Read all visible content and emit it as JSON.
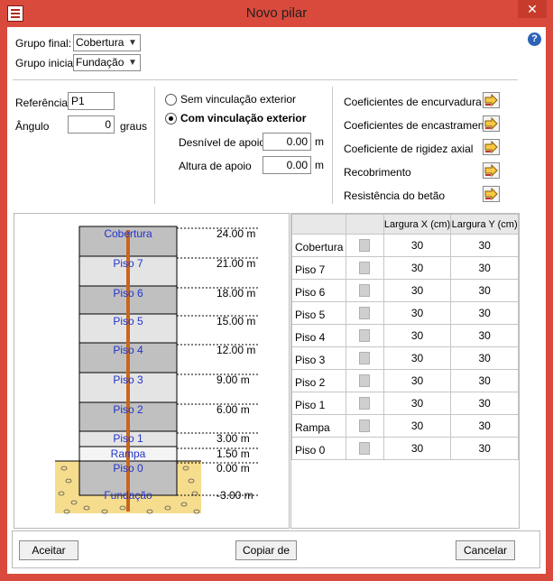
{
  "window": {
    "title": "Novo pilar",
    "close_glyph": "✕"
  },
  "help": {
    "glyph": "?"
  },
  "groups": {
    "final_label": "Grupo final:",
    "final_value": "Cobertura",
    "initial_label": "Grupo inicial:",
    "initial_value": "Fundação"
  },
  "fields": {
    "reference_label": "Referência",
    "reference_value": "P1",
    "angle_label": "Ângulo",
    "angle_value": "0",
    "angle_unit": "graus"
  },
  "link": {
    "option_without": "Sem vinculação exterior",
    "option_with": "Com vinculação exterior",
    "selected": "with",
    "drop_label": "Desnível de apoio",
    "drop_value": "0.00",
    "drop_unit": "m",
    "height_label": "Altura de apoio",
    "height_value": "0.00",
    "height_unit": "m"
  },
  "coefficients": [
    {
      "label": "Coeficientes de encurvadura"
    },
    {
      "label": "Coeficientes de encastramento"
    },
    {
      "label": "Coeficiente de rigidez axial"
    },
    {
      "label": "Recobrimento"
    },
    {
      "label": "Resistência do betão"
    }
  ],
  "elevation": {
    "levels": [
      {
        "name": "Cobertura",
        "elev": 24.0,
        "label": "24.00 m"
      },
      {
        "name": "Piso 7",
        "elev": 21.0,
        "label": "21.00 m"
      },
      {
        "name": "Piso 6",
        "elev": 18.0,
        "label": "18.00 m"
      },
      {
        "name": "Piso 5",
        "elev": 15.0,
        "label": "15.00 m"
      },
      {
        "name": "Piso 4",
        "elev": 12.0,
        "label": "12.00 m"
      },
      {
        "name": "Piso 3",
        "elev": 9.0,
        "label": "9.00 m"
      },
      {
        "name": "Piso 2",
        "elev": 6.0,
        "label": "6.00 m"
      },
      {
        "name": "Piso 1",
        "elev": 3.0,
        "label": "3.00 m"
      },
      {
        "name": "Rampa",
        "elev": 1.5,
        "label": "1.50 m"
      },
      {
        "name": "Piso 0",
        "elev": 0.0,
        "label": "0.00 m"
      },
      {
        "name": "Fundação",
        "elev": -3.0,
        "label": "-3.00 m"
      }
    ],
    "colors": {
      "dark": "#c0c0c0",
      "light": "#e4e4e4",
      "column": "#c8661c",
      "soil": "#f6dd8e",
      "label": "#2233cc"
    }
  },
  "table": {
    "headers": [
      "",
      "",
      "Largura X (cm)",
      "Largura Y (cm)"
    ],
    "rows": [
      {
        "name": "Cobertura",
        "x": "30",
        "y": "30"
      },
      {
        "name": "Piso 7",
        "x": "30",
        "y": "30"
      },
      {
        "name": "Piso 6",
        "x": "30",
        "y": "30"
      },
      {
        "name": "Piso 5",
        "x": "30",
        "y": "30"
      },
      {
        "name": "Piso 4",
        "x": "30",
        "y": "30"
      },
      {
        "name": "Piso 3",
        "x": "30",
        "y": "30"
      },
      {
        "name": "Piso 2",
        "x": "30",
        "y": "30"
      },
      {
        "name": "Piso 1",
        "x": "30",
        "y": "30"
      },
      {
        "name": "Rampa",
        "x": "30",
        "y": "30"
      },
      {
        "name": "Piso 0",
        "x": "30",
        "y": "30"
      }
    ]
  },
  "buttons": {
    "accept": "Aceitar",
    "copy": "Copiar de",
    "cancel": "Cancelar"
  }
}
